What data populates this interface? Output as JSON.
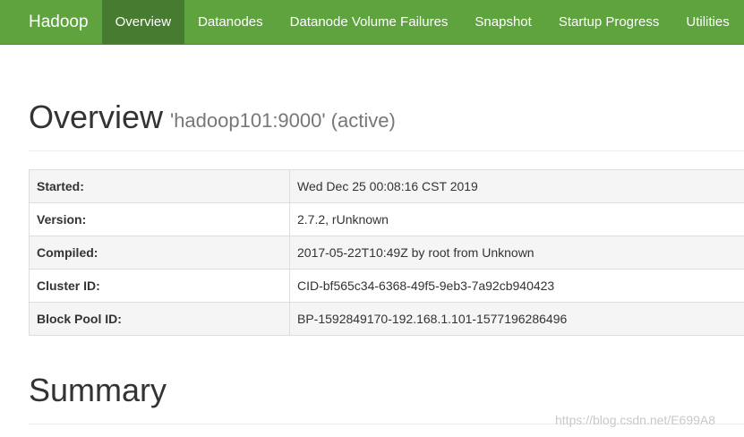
{
  "navbar": {
    "brand": "Hadoop",
    "items": [
      {
        "label": "Overview",
        "active": true
      },
      {
        "label": "Datanodes",
        "active": false
      },
      {
        "label": "Datanode Volume Failures",
        "active": false
      },
      {
        "label": "Snapshot",
        "active": false
      },
      {
        "label": "Startup Progress",
        "active": false
      },
      {
        "label": "Utilities",
        "active": false
      }
    ],
    "color": "#5fa33e",
    "active_color": "#477b2f"
  },
  "overview": {
    "title": "Overview",
    "subtitle": "'hadoop101:9000' (active)"
  },
  "info_table": [
    {
      "key": "Started:",
      "value": "Wed Dec 25 00:08:16 CST 2019"
    },
    {
      "key": "Version:",
      "value": "2.7.2, rUnknown"
    },
    {
      "key": "Compiled:",
      "value": "2017-05-22T10:49Z by root from Unknown"
    },
    {
      "key": "Cluster ID:",
      "value": "CID-bf565c34-6368-49f5-9eb3-7a92cb940423"
    },
    {
      "key": "Block Pool ID:",
      "value": "BP-1592849170-192.168.1.101-1577196286496"
    }
  ],
  "summary": {
    "title": "Summary"
  },
  "watermark": "https://blog.csdn.net/E699A8"
}
